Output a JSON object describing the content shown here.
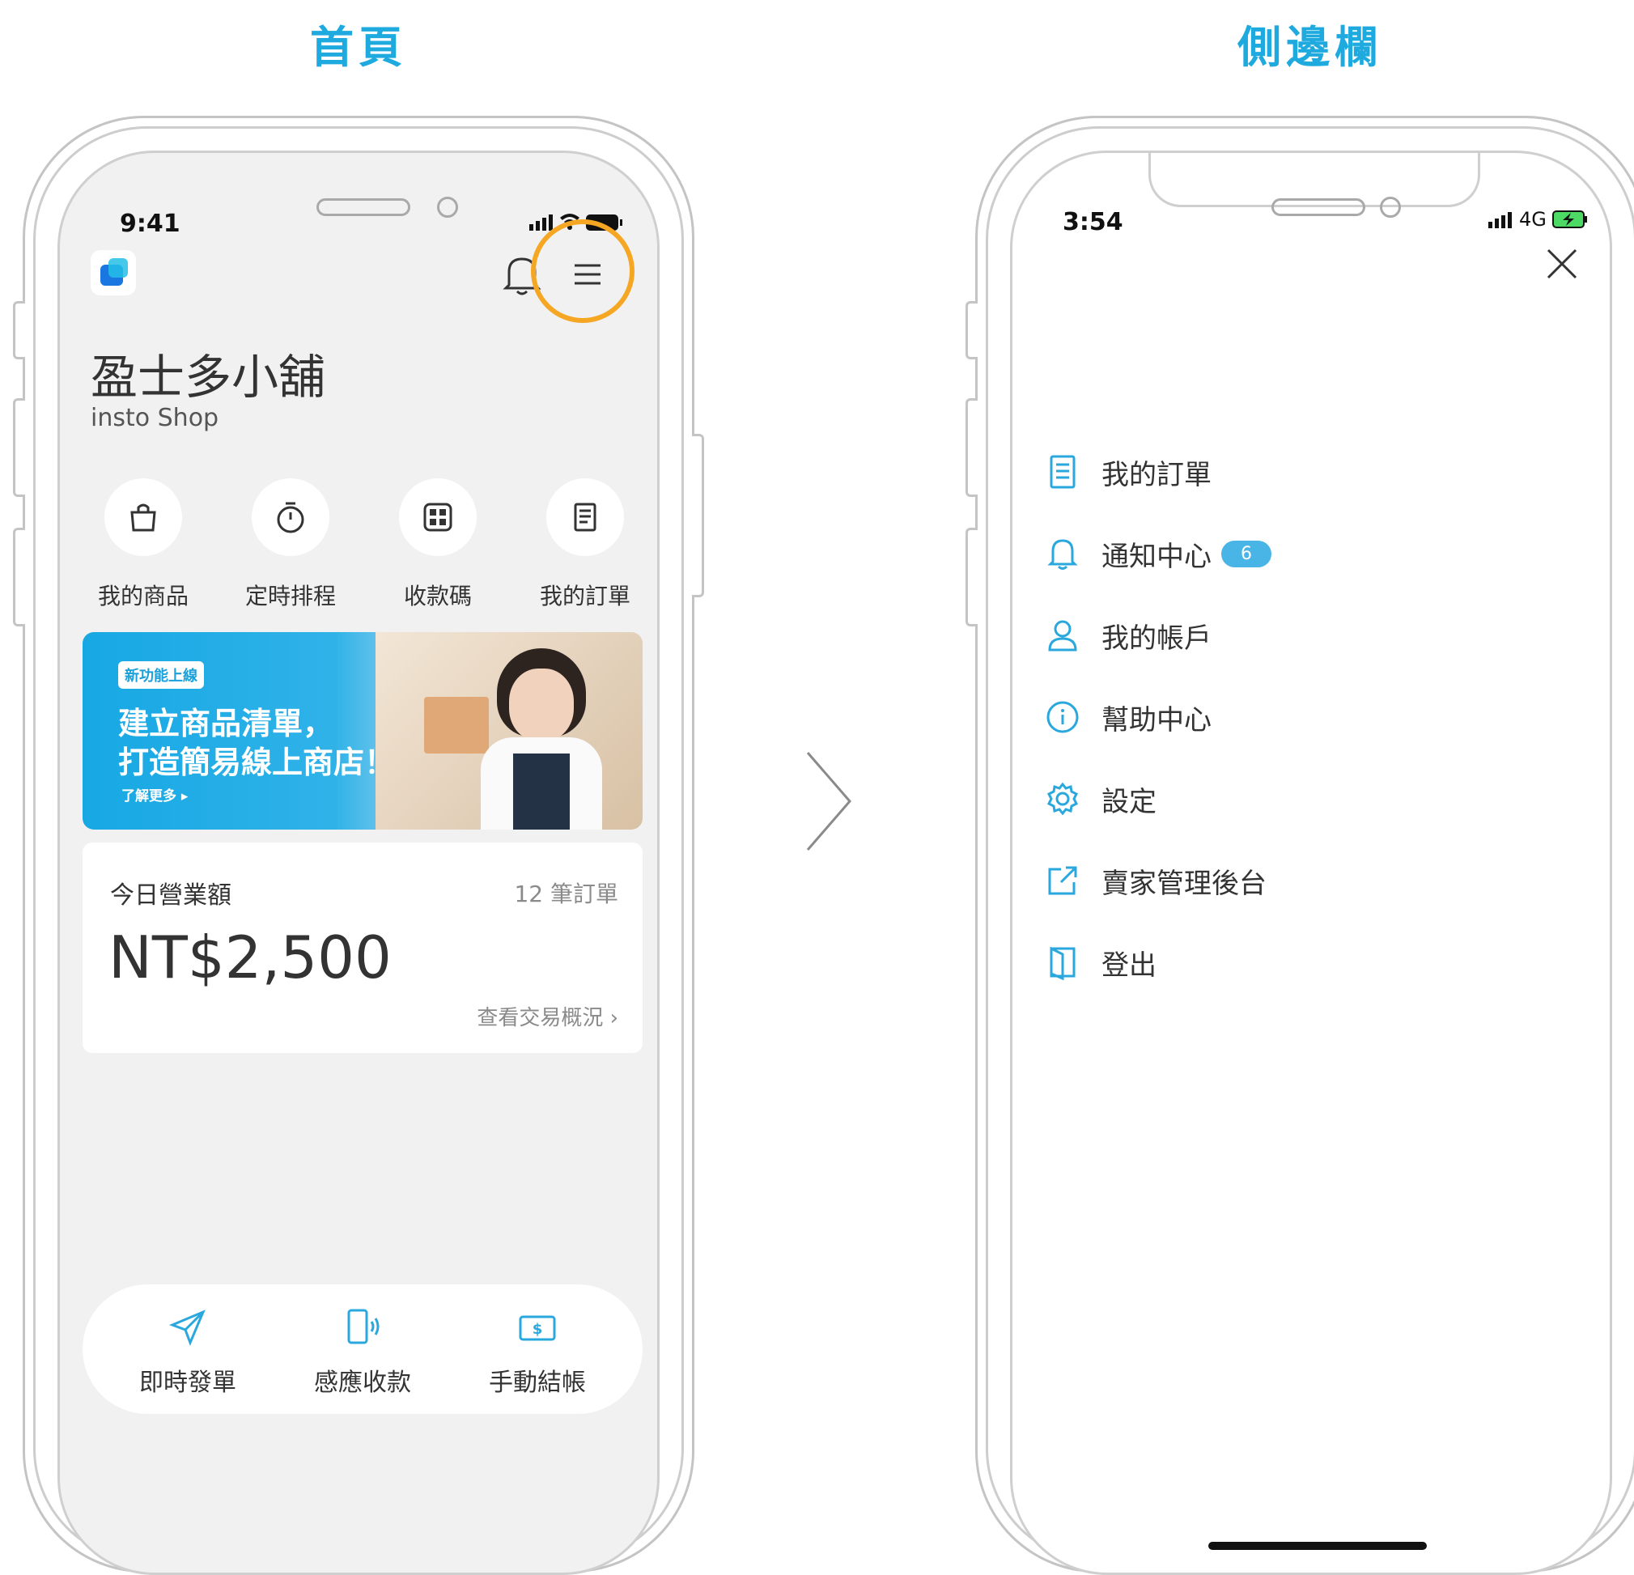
{
  "titles": {
    "left": "首頁",
    "right": "側邊欄"
  },
  "left_screen": {
    "status": {
      "time": "9:41"
    },
    "header": {
      "logo_icon": "app-logo",
      "notification_icon": "bell-icon",
      "menu_icon": "hamburger-menu-icon",
      "highlight_color": "#f5a623"
    },
    "brand": {
      "name": "盈士多小舖",
      "subtitle": "insto Shop"
    },
    "quick_actions": [
      {
        "label": "我的商品",
        "icon": "shopping-bag-icon"
      },
      {
        "label": "定時排程",
        "icon": "timer-icon"
      },
      {
        "label": "收款碼",
        "icon": "qr-code-icon"
      },
      {
        "label": "我的訂單",
        "icon": "receipt-icon"
      }
    ],
    "banner": {
      "badge": "新功能上線",
      "line1": "建立商品清單，",
      "line2": "打造簡易線上商店！",
      "more": "了解更多 ▸"
    },
    "sales_card": {
      "label": "今日營業額",
      "orders": "12 筆訂單",
      "amount": "NT$2,500",
      "link": "查看交易概況 ›"
    },
    "bottom_bar": [
      {
        "label": "即時發單",
        "icon": "send-icon"
      },
      {
        "label": "感應收款",
        "icon": "nfc-phone-icon"
      },
      {
        "label": "手動結帳",
        "icon": "cash-icon"
      }
    ]
  },
  "right_screen": {
    "status": {
      "time": "3:54",
      "network": "4G"
    },
    "menu": [
      {
        "label": "我的訂單",
        "icon": "receipt-icon"
      },
      {
        "label": "通知中心",
        "icon": "bell-icon",
        "badge": "6"
      },
      {
        "label": "我的帳戶",
        "icon": "user-icon"
      },
      {
        "label": "幫助中心",
        "icon": "info-icon"
      },
      {
        "label": "設定",
        "icon": "gear-icon"
      },
      {
        "label": "賣家管理後台",
        "icon": "external-link-icon"
      },
      {
        "label": "登出",
        "icon": "logout-icon"
      }
    ]
  },
  "colors": {
    "accent": "#1eaadf",
    "badge": "#49b4e6",
    "highlight": "#f5a623"
  }
}
